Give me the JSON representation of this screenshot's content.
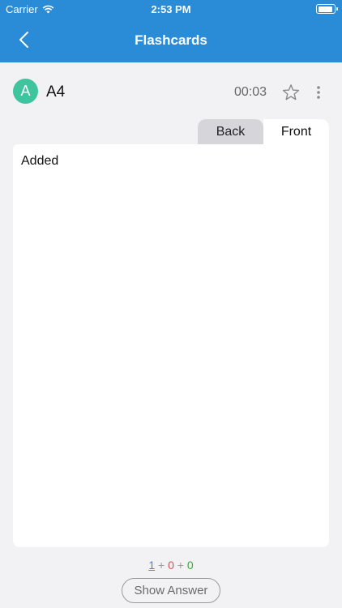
{
  "status_bar": {
    "carrier": "Carrier",
    "time": "2:53 PM",
    "wifi_icon": "wifi-icon",
    "battery_icon": "battery-icon"
  },
  "nav": {
    "title": "Flashcards",
    "back_icon": "chevron-left-icon"
  },
  "deck": {
    "avatar_letter": "A",
    "avatar_color": "#3ec49e",
    "name": "A4",
    "timer": "00:03",
    "star_icon": "star-outline-icon",
    "more_icon": "vertical-ellipsis-icon"
  },
  "tabs": [
    {
      "label": "Back",
      "selected": false
    },
    {
      "label": "Front",
      "selected": true
    }
  ],
  "card": {
    "text": "Added"
  },
  "counter": {
    "blue": "1",
    "sep1": "+",
    "red": "0",
    "sep2": "+",
    "green": "0"
  },
  "actions": {
    "show_answer": "Show Answer"
  },
  "colors": {
    "header": "#2a8bd6",
    "background": "#f2f2f4",
    "blue_count": "#3a8bd0",
    "red_count": "#d05555",
    "green_count": "#3aa83a"
  }
}
